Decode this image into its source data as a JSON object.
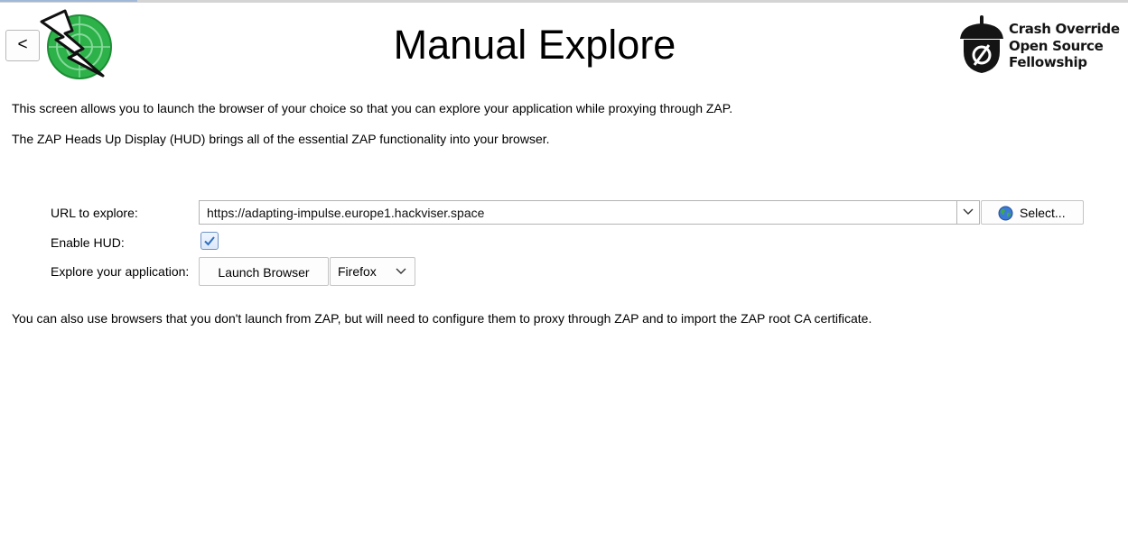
{
  "header": {
    "back_label": "<",
    "title": "Manual Explore",
    "fellowship": {
      "line1": "Crash Override",
      "line2": "Open Source",
      "line3": "Fellowship"
    }
  },
  "intro": {
    "line1": "This screen allows you to launch the browser of your choice so that you can explore your application while proxying through ZAP.",
    "line2": "The ZAP Heads Up Display (HUD) brings all of the essential ZAP functionality into your browser."
  },
  "form": {
    "url_label": "URL to explore:",
    "url_value": "https://adapting-impulse.europe1.hackviser.space",
    "select_label": "Select...",
    "hud_label": "Enable HUD:",
    "hud_enabled": true,
    "explore_label": "Explore your application:",
    "launch_label": "Launch Browser",
    "browser_selected": "Firefox"
  },
  "footer": {
    "text": "You can also use browsers that you don't launch from ZAP, but will need to configure them to proxy through ZAP and to import the ZAP root CA certificate."
  },
  "icons": {
    "back": "chevron-left",
    "zap_logo": "zap-lightning-radar-logo",
    "fellowship_logo": "acorn-logo",
    "select": "globe-icon",
    "dropdown": "chevron-down-icon",
    "checkbox": "checkmark-icon"
  },
  "colors": {
    "zap_green": "#2db24a",
    "checkbox_border": "#6f93c4",
    "checkmark": "#2f6fc0"
  }
}
